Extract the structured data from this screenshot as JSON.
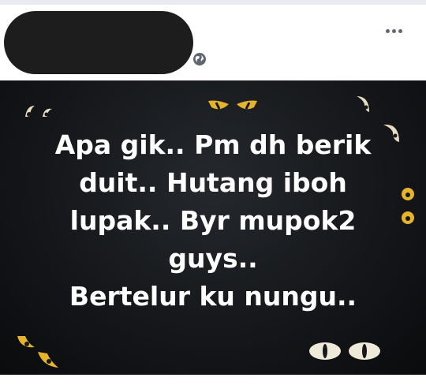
{
  "header": {
    "more_label": "•••",
    "privacy_icon": "globe-icon"
  },
  "post": {
    "background_color": "#15171a",
    "text_color": "#ffffff",
    "lines": [
      "Apa gik.. Pm dh berik",
      "duit.. Hutang iboh",
      "lupak.. Byr mupok2",
      "guys..",
      "Bertelur ku nungu.."
    ],
    "decorations": [
      "eyes-icon",
      "eyes-icon",
      "eyes-icon",
      "eyes-icon",
      "eyes-icon",
      "eyes-icon",
      "eyes-icon"
    ]
  }
}
